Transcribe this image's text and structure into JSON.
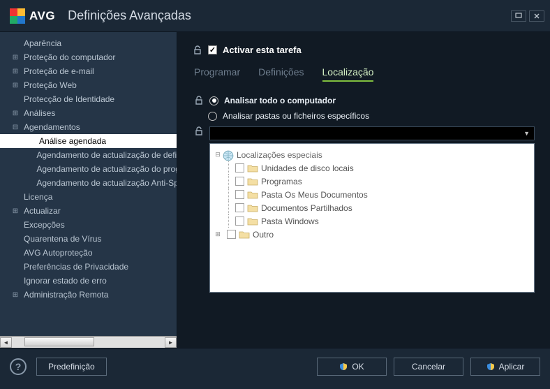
{
  "window": {
    "title": "Definições Avançadas",
    "logo_text": "AVG"
  },
  "sidebar": {
    "items": [
      {
        "label": "Aparência",
        "level": 1,
        "expander": "none"
      },
      {
        "label": "Proteção do computador",
        "level": 1,
        "expander": "plus"
      },
      {
        "label": "Proteção de e-mail",
        "level": 1,
        "expander": "plus"
      },
      {
        "label": "Proteção Web",
        "level": 1,
        "expander": "plus"
      },
      {
        "label": "Protecção de Identidade",
        "level": 1,
        "expander": "none"
      },
      {
        "label": "Análises",
        "level": 1,
        "expander": "plus"
      },
      {
        "label": "Agendamentos",
        "level": 1,
        "expander": "minus"
      },
      {
        "label": "Análise agendada",
        "level": 2,
        "expander": "none",
        "selected": true
      },
      {
        "label": "Agendamento de actualização de definições",
        "level": 2,
        "expander": "none"
      },
      {
        "label": "Agendamento de actualização do programa",
        "level": 2,
        "expander": "none"
      },
      {
        "label": "Agendamento de actualização Anti-Spam",
        "level": 2,
        "expander": "none"
      },
      {
        "label": "Licença",
        "level": 1,
        "expander": "none"
      },
      {
        "label": "Actualizar",
        "level": 1,
        "expander": "plus"
      },
      {
        "label": "Excepções",
        "level": 1,
        "expander": "none"
      },
      {
        "label": "Quarentena de Vírus",
        "level": 1,
        "expander": "none"
      },
      {
        "label": "AVG Autoproteção",
        "level": 1,
        "expander": "none"
      },
      {
        "label": "Preferências de Privacidade",
        "level": 1,
        "expander": "none"
      },
      {
        "label": "Ignorar estado de erro",
        "level": 1,
        "expander": "none"
      },
      {
        "label": "Administração Remota",
        "level": 1,
        "expander": "plus"
      }
    ]
  },
  "content": {
    "activate_label": "Activar esta tarefa",
    "activate_checked": true,
    "tabs": [
      {
        "label": "Programar",
        "active": false
      },
      {
        "label": "Definições",
        "active": false
      },
      {
        "label": "Localização",
        "active": true
      }
    ],
    "radios": [
      {
        "label": "Analisar todo o computador",
        "checked": true
      },
      {
        "label": "Analisar pastas ou ficheiros específicos",
        "checked": false
      }
    ],
    "locations": {
      "root_label": "Localizações especiais",
      "items": [
        {
          "label": "Unidades de disco locais"
        },
        {
          "label": "Programas"
        },
        {
          "label": "Pasta Os Meus Documentos"
        },
        {
          "label": "Documentos Partilhados"
        },
        {
          "label": "Pasta Windows"
        }
      ],
      "other_label": "Outro"
    }
  },
  "footer": {
    "preset": "Predefinição",
    "ok": "OK",
    "cancel": "Cancelar",
    "apply": "Aplicar"
  }
}
